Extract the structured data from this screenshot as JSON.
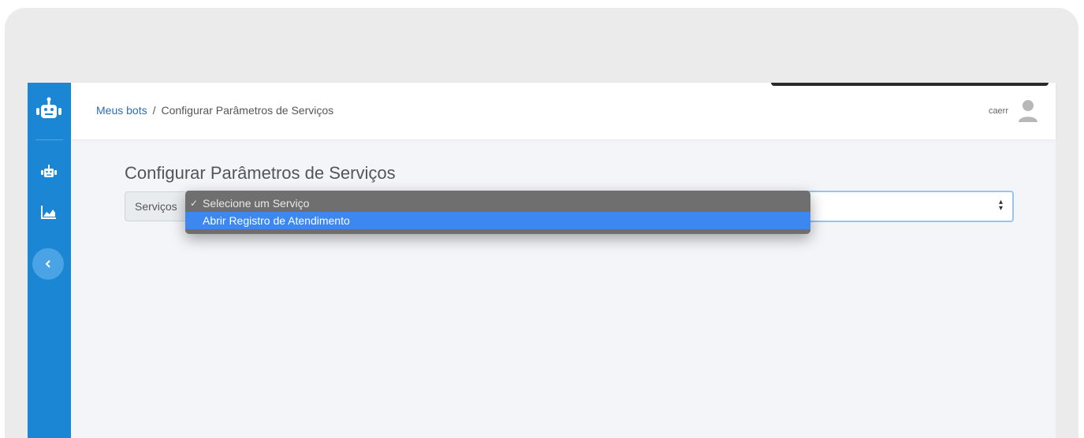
{
  "breadcrumb": {
    "root": "Meus bots",
    "separator": "/",
    "current": "Configurar Parâmetros de Serviços"
  },
  "user": {
    "name": "caerr",
    "avatar_icon": "user-avatar-icon"
  },
  "page": {
    "title": "Configurar Parâmetros de Serviços"
  },
  "service_select": {
    "addon_label": "Serviços",
    "selected": "Selecione um Serviço",
    "options": [
      "Selecione um Serviço",
      "Abrir Registro de Atendimento"
    ],
    "highlighted_index": 1
  },
  "sidebar": {
    "items": [
      {
        "icon": "robot-logo-icon"
      },
      {
        "icon": "robot-icon"
      },
      {
        "icon": "area-chart-icon"
      },
      {
        "icon": "chevron-left-icon"
      }
    ]
  },
  "colors": {
    "sidebar": "#1b87d4",
    "highlight": "#3d87f0",
    "link": "#2a6fb3"
  }
}
